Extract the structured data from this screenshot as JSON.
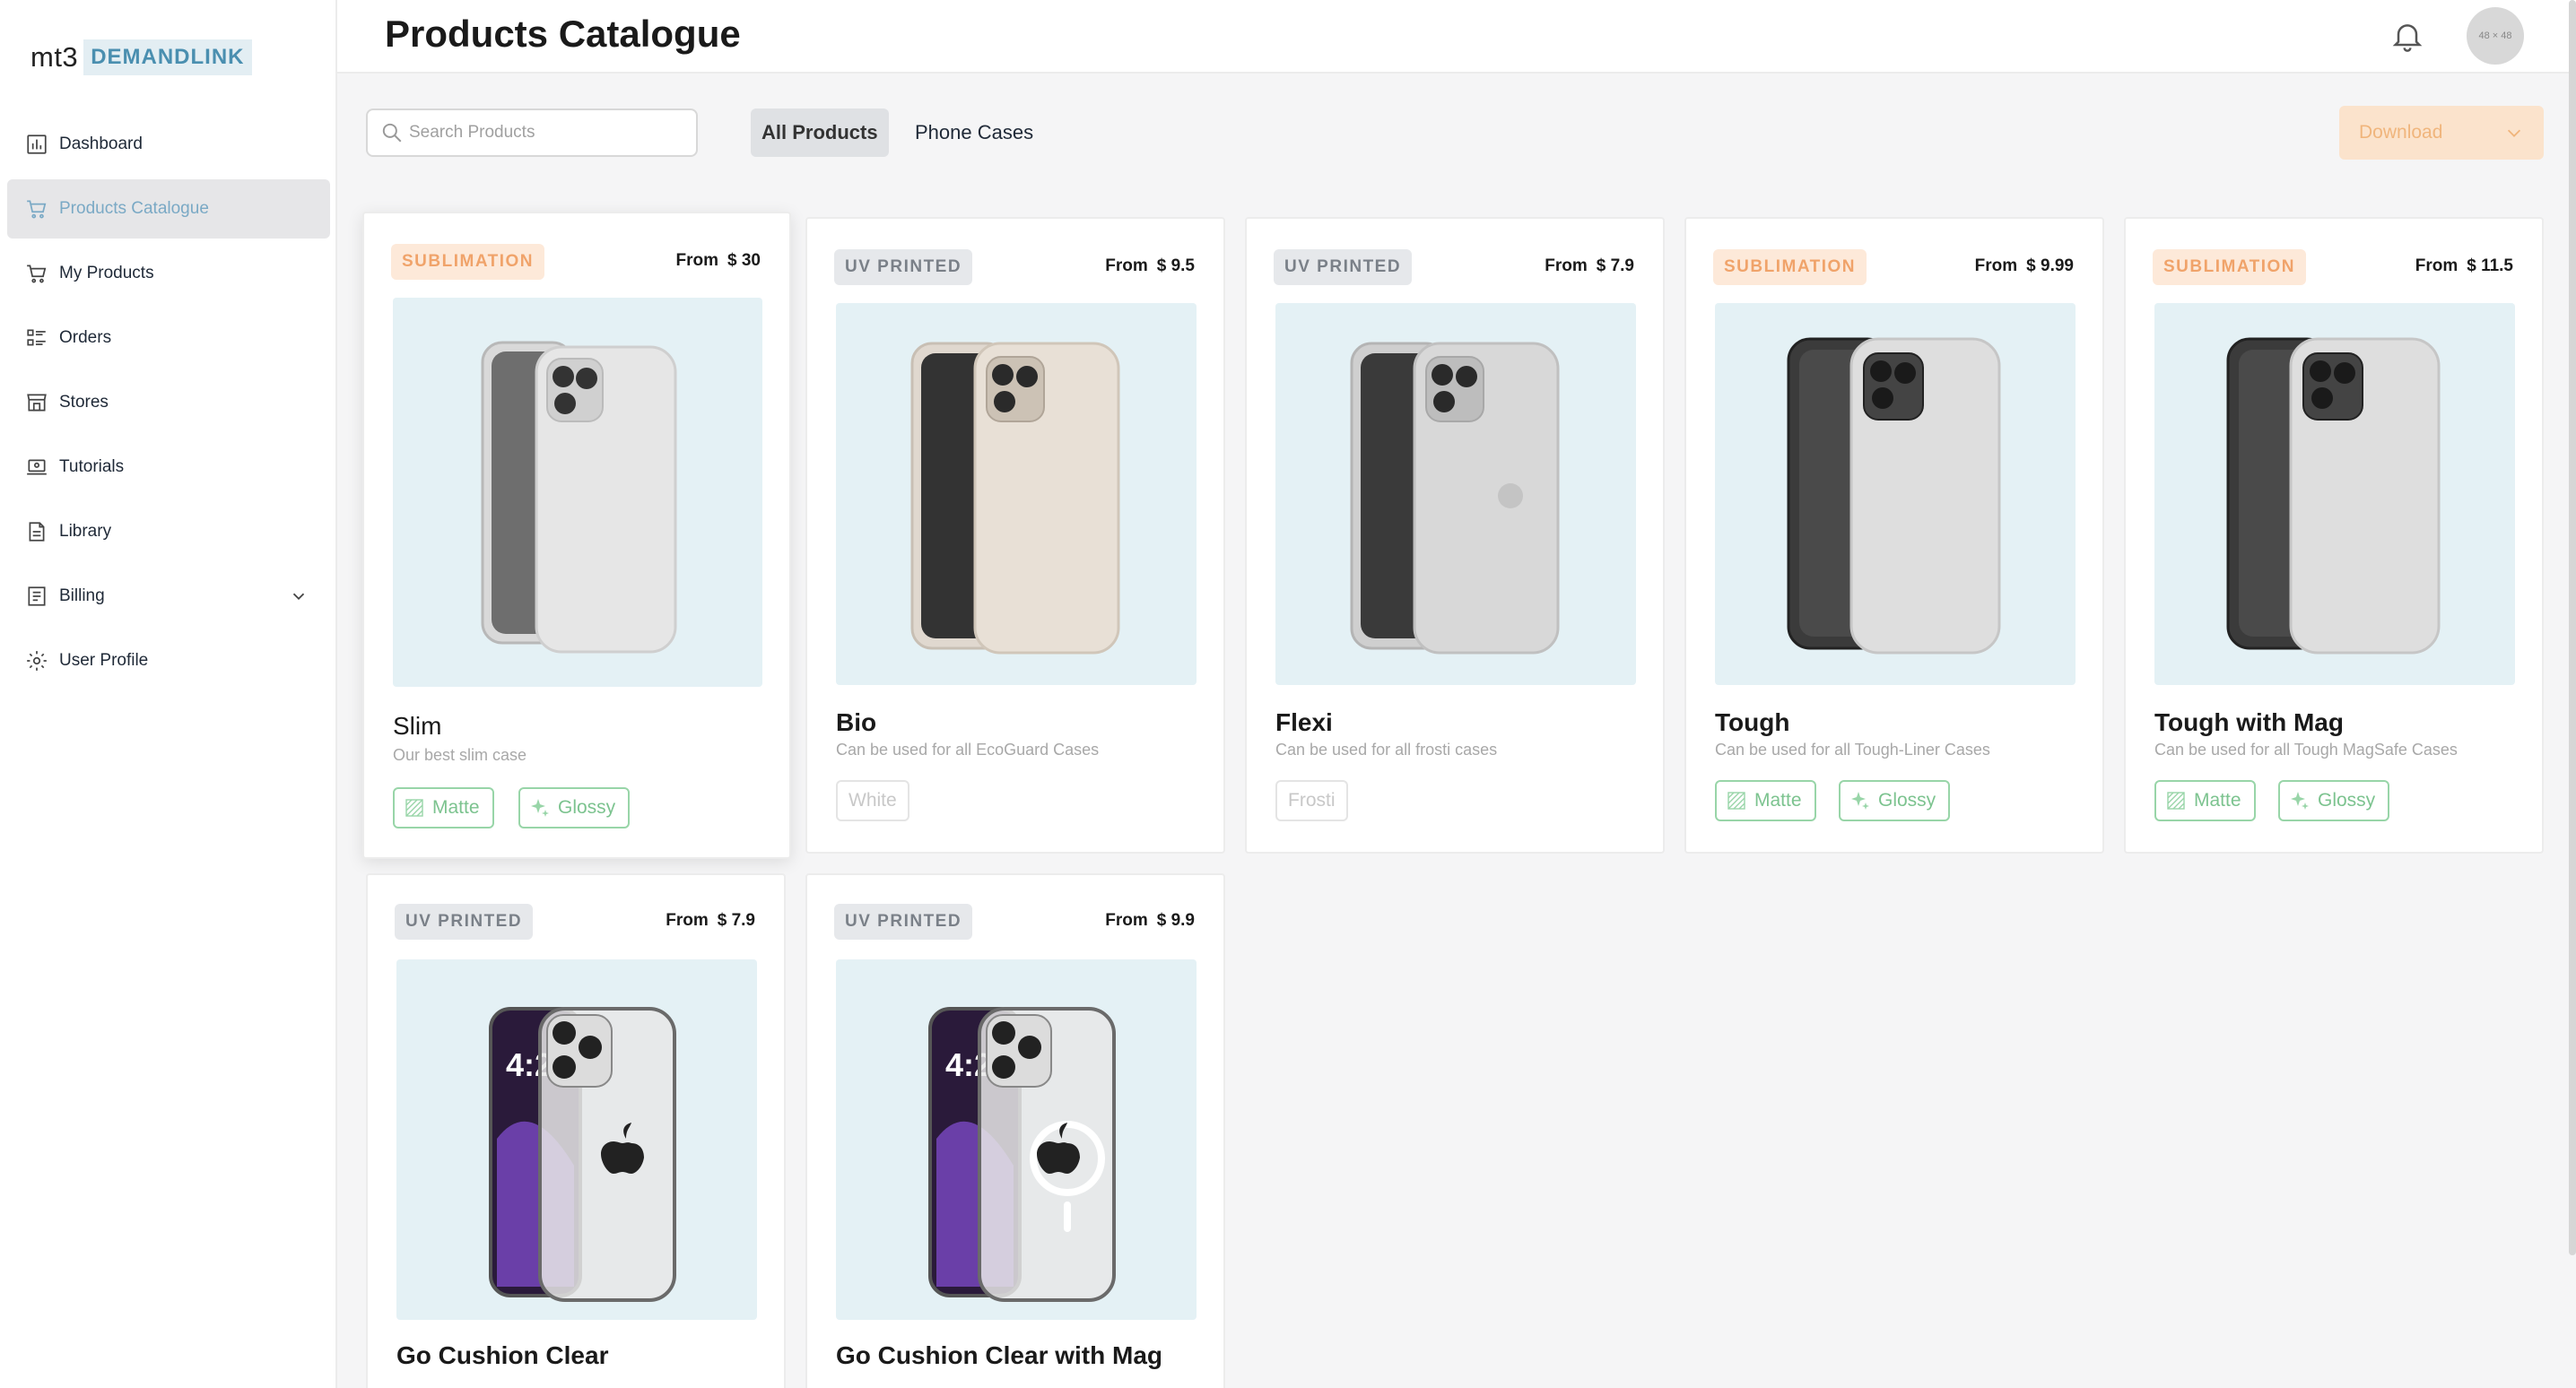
{
  "app": {
    "logo_prefix": "mt3",
    "logo_brand": "DEMANDLINK"
  },
  "sidebar": {
    "items": [
      {
        "label": "Dashboard",
        "icon": "chart-icon"
      },
      {
        "label": "Products Catalogue",
        "icon": "cart-icon",
        "active": true
      },
      {
        "label": "My Products",
        "icon": "cart-icon"
      },
      {
        "label": "Orders",
        "icon": "list-icon"
      },
      {
        "label": "Stores",
        "icon": "store-icon"
      },
      {
        "label": "Tutorials",
        "icon": "laptop-icon"
      },
      {
        "label": "Library",
        "icon": "document-icon"
      },
      {
        "label": "Billing",
        "icon": "receipt-icon",
        "expandable": true
      },
      {
        "label": "User Profile",
        "icon": "gear-icon"
      }
    ]
  },
  "header": {
    "title": "Products Catalogue",
    "avatar_text": "48 × 48"
  },
  "toolbar": {
    "search_placeholder": "Search Products",
    "tabs": [
      {
        "label": "All Products",
        "active": true
      },
      {
        "label": "Phone Cases",
        "active": false
      }
    ],
    "download_label": "Download"
  },
  "products": [
    {
      "badge": "SUBLIMATION",
      "badge_type": "sublimation",
      "from": "From",
      "price": "$ 30",
      "name": "Slim",
      "desc": "Our best slim case",
      "finishes": [
        "Matte",
        "Glossy"
      ],
      "image": "white-case"
    },
    {
      "badge": "UV PRINTED",
      "badge_type": "uv",
      "from": "From",
      "price": "$ 9.5",
      "name": "Bio",
      "desc": "Can be used for all EcoGuard Cases",
      "finishes": [
        "White"
      ],
      "image": "speckled-case"
    },
    {
      "badge": "UV PRINTED",
      "badge_type": "uv",
      "from": "From",
      "price": "$ 7.9",
      "name": "Flexi",
      "desc": "Can be used for all frosti cases",
      "finishes": [
        "Frosti"
      ],
      "image": "frosted-case"
    },
    {
      "badge": "SUBLIMATION",
      "badge_type": "sublimation",
      "from": "From",
      "price": "$ 9.99",
      "name": "Tough",
      "desc": "Can be used for all Tough-Liner Cases",
      "finishes": [
        "Matte",
        "Glossy"
      ],
      "image": "tough-case"
    },
    {
      "badge": "SUBLIMATION",
      "badge_type": "sublimation",
      "from": "From",
      "price": "$ 11.5",
      "name": "Tough with Mag",
      "desc": "Can be used for all Tough MagSafe Cases",
      "finishes": [
        "Matte",
        "Glossy"
      ],
      "image": "tough-case"
    },
    {
      "badge": "UV PRINTED",
      "badge_type": "uv",
      "from": "From",
      "price": "$ 7.9",
      "name": "Go Cushion Clear",
      "desc": "",
      "finishes": [],
      "image": "clear-case",
      "screen_time": "4:2"
    },
    {
      "badge": "UV PRINTED",
      "badge_type": "uv",
      "from": "From",
      "price": "$ 9.9",
      "name": "Go Cushion Clear with Mag",
      "desc": "",
      "finishes": [],
      "image": "clear-mag-case",
      "screen_time": "4:2"
    }
  ],
  "colors": {
    "accent_blue": "#7aa9c5",
    "sublimation_badge": "#f0a36a",
    "finish_green": "#7cc38f",
    "download_bg": "#fbe3cc",
    "image_bg": "#e4f1f5"
  }
}
